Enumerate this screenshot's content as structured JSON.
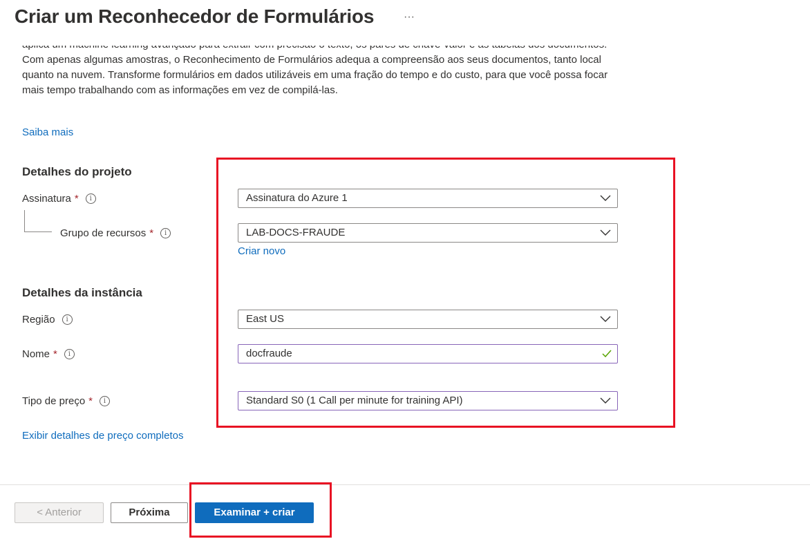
{
  "header": {
    "title": "Criar um Reconhecedor de Formulários",
    "more_label": "···"
  },
  "intro": {
    "text": "aplica um machine learning avançado para extrair com precisão o texto, os pares de chave-valor e as tabelas dos documentos. Com apenas algumas amostras, o Reconhecimento de Formulários adequa a compreensão aos seus documentos, tanto local quanto na nuvem. Transforme formulários em dados utilizáveis em uma fração do tempo e do custo, para que você possa focar mais tempo trabalhando com as informações em vez de compilá-las.",
    "learn_more": "Saiba mais"
  },
  "project": {
    "heading": "Detalhes do projeto",
    "subscription_label": "Assinatura",
    "subscription_value": "Assinatura do Azure 1",
    "resource_group_label": "Grupo de recursos",
    "resource_group_value": "LAB-DOCS-FRAUDE",
    "create_new": "Criar novo"
  },
  "instance": {
    "heading": "Detalhes da instância",
    "region_label": "Região",
    "region_value": "East US",
    "name_label": "Nome",
    "name_value": "docfraude",
    "pricing_label": "Tipo de preço",
    "pricing_value": "Standard S0 (1 Call per minute for training API)",
    "pricing_details": "Exibir detalhes de preço completos"
  },
  "symbols": {
    "required": "*",
    "info": "i"
  },
  "footer": {
    "prev": "< Anterior",
    "next": "Próxima",
    "review": "Examinar + criar"
  },
  "colors": {
    "accent": "#0f6cbd",
    "highlight": "#e81123",
    "required": "#a4262c",
    "valid": "#57a300",
    "focus_border": "#8764b8"
  },
  "icons": {
    "dropdown": "chevron-down-icon",
    "valid": "checkmark-icon",
    "info": "info-icon",
    "more": "more-icon"
  }
}
